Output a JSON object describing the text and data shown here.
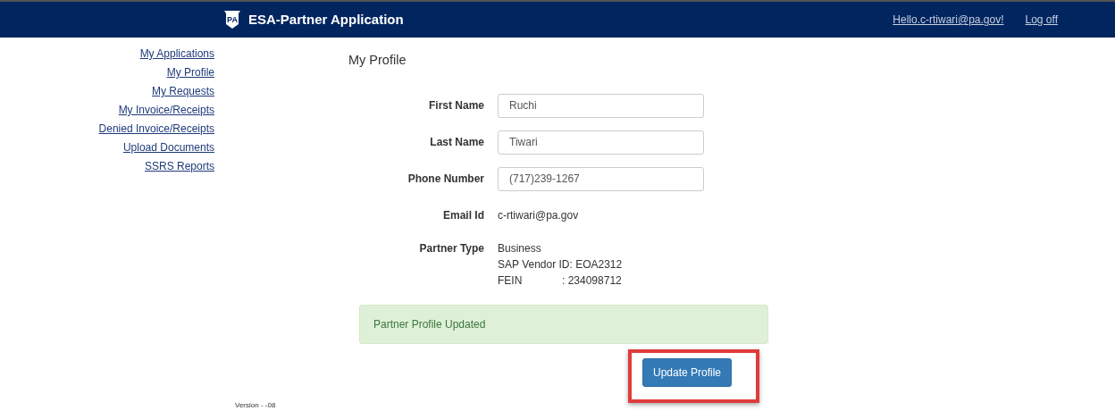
{
  "header": {
    "title": "ESA-Partner Application",
    "logo": "PA",
    "greeting": "Hello.c-rtiwari@pa.gov!",
    "logoff": "Log off"
  },
  "sidebar": {
    "items": [
      {
        "label": "My Applications"
      },
      {
        "label": "My Profile"
      },
      {
        "label": "My Requests"
      },
      {
        "label": "My Invoice/Receipts"
      },
      {
        "label": "Denied Invoice/Receipts"
      },
      {
        "label": "Upload Documents"
      },
      {
        "label": "SSRS Reports"
      }
    ]
  },
  "page_title": "My Profile",
  "fields": [
    {
      "kind": "input",
      "label": "First Name",
      "value": "Ruchi"
    },
    {
      "kind": "input",
      "label": "Last Name",
      "value": "Tiwari"
    },
    {
      "kind": "input",
      "label": "Phone Number",
      "value": "(717)239-1267"
    },
    {
      "kind": "text",
      "label": "Email Id",
      "value": "c-rtiwari@pa.gov"
    }
  ],
  "partner_type": {
    "label": "Partner Type",
    "type": "Business",
    "vendor_id": "SAP Vendor ID: EOA2312",
    "fein_label": "FEIN",
    "fein_value": ": 234098712"
  },
  "alert": "Partner Profile Updated",
  "update_button": {
    "label": "Update Profile",
    "highlighted": true
  },
  "version": "Version - -08"
}
